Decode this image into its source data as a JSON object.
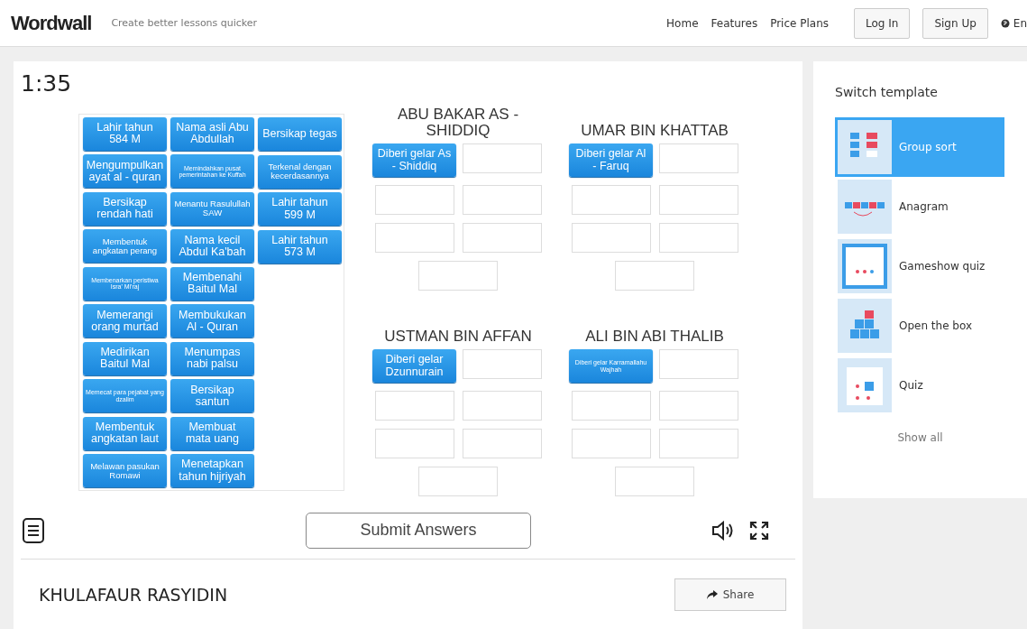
{
  "header": {
    "logo": "Wordwall",
    "tagline": "Create better lessons quicker",
    "nav": [
      "Home",
      "Features",
      "Price Plans"
    ],
    "buttons": [
      "Log In",
      "Sign Up"
    ],
    "language": "En"
  },
  "game": {
    "timer": "1:35",
    "pool": [
      [
        {
          "text": "Lahir tahun 584 M",
          "kind": "normal"
        },
        {
          "text": "Mengumpulkan ayat al - quran",
          "kind": "normal"
        },
        {
          "text": "Bersikap rendah hati",
          "kind": "normal"
        },
        {
          "text": "Membentuk angkatan perang",
          "kind": "small"
        },
        {
          "text": "Membenarkan peristiwa Isra' Mi'raj",
          "kind": "tiny"
        },
        {
          "text": "Memerangi orang murtad",
          "kind": "normal"
        },
        {
          "text": "Medirikan Baitul Mal",
          "kind": "normal"
        },
        {
          "text": "Memecat para pejabat yang dzalim",
          "kind": "tiny"
        },
        {
          "text": "Membentuk angkatan laut",
          "kind": "normal"
        },
        {
          "text": "Melawan pasukan Romawi",
          "kind": "small"
        }
      ],
      [
        {
          "text": "Nama asli Abu Abdullah",
          "kind": "normal"
        },
        {
          "text": "Memindahkan pusat pemerintahan ke Kuffah",
          "kind": "tiny"
        },
        {
          "text": "Menantu Rasulullah SAW",
          "kind": "small"
        },
        {
          "text": "Nama kecil Abdul Ka'bah",
          "kind": "normal"
        },
        {
          "text": "Membenahi Baitul Mal",
          "kind": "normal"
        },
        {
          "text": "Membukukan Al - Quran",
          "kind": "normal"
        },
        {
          "text": "Menumpas nabi palsu",
          "kind": "normal"
        },
        {
          "text": "Bersikap santun",
          "kind": "normal"
        },
        {
          "text": "Membuat mata uang",
          "kind": "normal"
        },
        {
          "text": "Menetapkan tahun hijriyah",
          "kind": "normal"
        }
      ],
      [
        {
          "text": "Bersikap tegas",
          "kind": "normal"
        },
        {
          "text": "Terkenal dengan kecerdasannya",
          "kind": "small"
        },
        {
          "text": "Lahir tahun 599 M",
          "kind": "normal"
        },
        {
          "text": "Lahir tahun 573 M",
          "kind": "normal"
        }
      ]
    ],
    "groups": [
      {
        "title": "ABU BAKAR AS - SHIDDIQ",
        "slots": [
          {
            "empty": false,
            "text": "Diberi gelar As - Shiddiq",
            "kind": "normal"
          },
          {
            "empty": true
          },
          {
            "empty": true
          },
          {
            "empty": true
          },
          {
            "empty": true
          },
          {
            "empty": true
          },
          {
            "empty": true
          }
        ]
      },
      {
        "title": "UMAR BIN KHATTAB",
        "slots": [
          {
            "empty": false,
            "text": "Diberi gelar Al - Faruq",
            "kind": "normal"
          },
          {
            "empty": true
          },
          {
            "empty": true
          },
          {
            "empty": true
          },
          {
            "empty": true
          },
          {
            "empty": true
          },
          {
            "empty": true
          }
        ]
      },
      {
        "title": "USTMAN BIN AFFAN",
        "slots": [
          {
            "empty": false,
            "text": "Diberi gelar Dzunnurain",
            "kind": "normal"
          },
          {
            "empty": true
          },
          {
            "empty": true
          },
          {
            "empty": true
          },
          {
            "empty": true
          },
          {
            "empty": true
          },
          {
            "empty": true
          }
        ]
      },
      {
        "title": "ALI BIN ABI THALIB",
        "slots": [
          {
            "empty": false,
            "text": "Diberi gelar Karramallahu Wajhah",
            "kind": "tiny"
          },
          {
            "empty": true
          },
          {
            "empty": true
          },
          {
            "empty": true
          },
          {
            "empty": true
          },
          {
            "empty": true
          },
          {
            "empty": true
          }
        ]
      }
    ],
    "submit": "Submit Answers"
  },
  "activity": {
    "title": "KHULAFAUR RASYIDIN",
    "share": "Share"
  },
  "templates": {
    "heading": "Switch template",
    "items": [
      {
        "label": "Group sort",
        "kind": "group-sort",
        "selected": true
      },
      {
        "label": "Anagram",
        "kind": "anagram",
        "selected": false
      },
      {
        "label": "Gameshow quiz",
        "kind": "gameshow",
        "selected": false
      },
      {
        "label": "Open the box",
        "kind": "open-box",
        "selected": false
      },
      {
        "label": "Quiz",
        "kind": "quiz",
        "selected": false
      }
    ],
    "show_all": "Show all"
  }
}
